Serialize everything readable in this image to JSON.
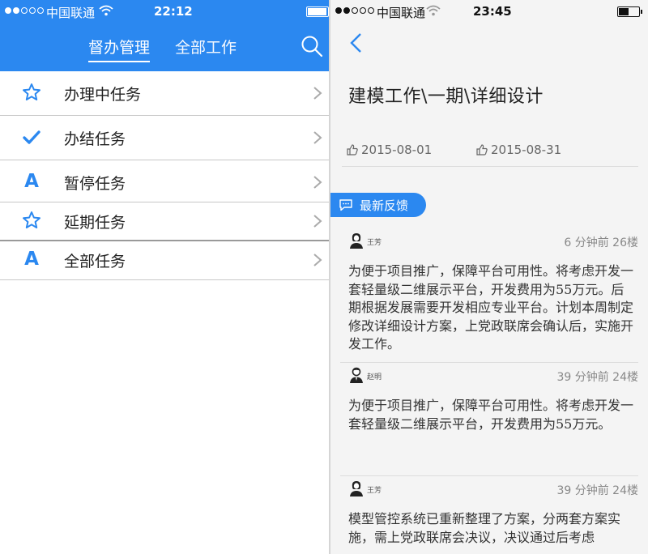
{
  "left": {
    "status": {
      "carrier": "中国联通",
      "time": "22:12"
    },
    "tabs": [
      {
        "label": "督办管理",
        "active": true
      },
      {
        "label": "全部工作",
        "active": false
      }
    ],
    "tasks": [
      {
        "label": "办理中任务",
        "icon": "star-outline-icon"
      },
      {
        "label": "办结任务",
        "icon": "checkmark-icon"
      },
      {
        "label": "暂停任务",
        "icon": "letter-a-icon",
        "glyph": "A"
      },
      {
        "label": "延期任务",
        "icon": "star-outline-icon"
      },
      {
        "label": "全部任务",
        "icon": "letter-a-icon",
        "glyph": "A"
      }
    ]
  },
  "right": {
    "status": {
      "carrier": "中国联通",
      "time": "23:45"
    },
    "title": "建模工作\\一期\\详细设计",
    "start_date": "2015-08-01",
    "end_date": "2015-08-31",
    "feedback_label": "最新反馈",
    "comments": [
      {
        "name": "王芳",
        "meta": "6 分钟前 26楼",
        "avatar": "female-avatar-icon",
        "body": "为便于项目推广，保障平台可用性。将考虑开发一套轻量级二维展示平台，开发费用为55万元。后期根据发展需要开发相应专业平台。计划本周制定修改详细设计方案，上党政联席会确认后，实施开发工作。"
      },
      {
        "name": "赵明",
        "meta": "39 分钟前 24楼",
        "avatar": "male-avatar-icon",
        "body": "为便于项目推广，保障平台可用性。将考虑开发一套轻量级二维展示平台，开发费用为55万元。"
      },
      {
        "name": "王芳",
        "meta": "39 分钟前 24楼",
        "avatar": "female-avatar-icon",
        "body": "模型管控系统已重新整理了方案，分两套方案实施，需上党政联席会决议，决议通过后考虑"
      }
    ]
  },
  "colors": {
    "accent": "#2b88f0",
    "text": "#222222",
    "meta": "#888888"
  }
}
